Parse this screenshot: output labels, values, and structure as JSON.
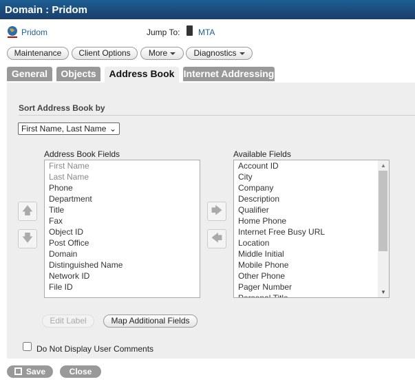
{
  "title": "Domain : Pridom",
  "domain_link": "Pridom",
  "jump_to_label": "Jump To:",
  "jump_to_link": "MTA",
  "toolbar": {
    "maintenance": "Maintenance",
    "client_options": "Client Options",
    "more": "More",
    "diagnostics": "Diagnostics"
  },
  "tabs": [
    "General",
    "Objects",
    "Address Book",
    "Internet Addressing"
  ],
  "sort_heading": "Sort Address Book by",
  "sort_value": "First Name, Last Name",
  "address_book_fields_label": "Address Book Fields",
  "address_book_fields": [
    "First Name",
    "Last Name",
    "Phone",
    "Department",
    "Title",
    "Fax",
    "Object ID",
    "Post Office",
    "Domain",
    "Distinguished Name",
    "Network ID",
    "File ID"
  ],
  "available_fields_label": "Available Fields",
  "available_fields": [
    "Account ID",
    "City",
    "Company",
    "Description",
    "Qualifier",
    "Home Phone",
    "Internet Free Busy URL",
    "Location",
    "Middle Initial",
    "Mobile Phone",
    "Other Phone",
    "Pager Number",
    "Personal Title"
  ],
  "edit_label": "Edit Label",
  "map_fields": "Map Additional Fields",
  "no_comments_label": "Do Not Display User Comments",
  "no_comments_checked": false,
  "save": "Save",
  "close": "Close"
}
